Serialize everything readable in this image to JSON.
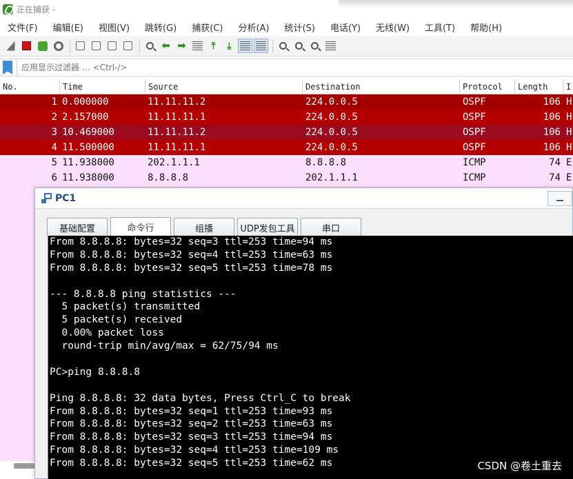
{
  "wireshark": {
    "title": "正在捕获 -",
    "menu": [
      "文件(F)",
      "编辑(E)",
      "视图(V)",
      "跳转(G)",
      "捕获(C)",
      "分析(A)",
      "统计(S)",
      "电话(Y)",
      "无线(W)",
      "工具(T)",
      "帮助(H)"
    ],
    "filter_placeholder": "应用显示过滤器 … <Ctrl-/>",
    "columns": [
      "No.",
      "Time",
      "Source",
      "Destination",
      "Protocol",
      "Length",
      "I"
    ],
    "rows": [
      {
        "no": "1",
        "time": "0.000000",
        "src": "11.11.11.2",
        "dst": "224.0.0.5",
        "proto": "OSPF",
        "len": "106",
        "info": "H",
        "bg": "#a40000",
        "fg": "#ffffff"
      },
      {
        "no": "2",
        "time": "2.157000",
        "src": "11.11.11.1",
        "dst": "224.0.0.5",
        "proto": "OSPF",
        "len": "106",
        "info": "H",
        "bg": "#b50000",
        "fg": "#ffffff"
      },
      {
        "no": "3",
        "time": "10.469000",
        "src": "11.11.11.2",
        "dst": "224.0.0.5",
        "proto": "OSPF",
        "len": "106",
        "info": "H",
        "bg": "#9c0a1e",
        "fg": "#ffffff"
      },
      {
        "no": "4",
        "time": "11.500000",
        "src": "11.11.11.1",
        "dst": "224.0.0.5",
        "proto": "OSPF",
        "len": "106",
        "info": "H",
        "bg": "#b50000",
        "fg": "#ffffff"
      },
      {
        "no": "5",
        "time": "11.938000",
        "src": "202.1.1.1",
        "dst": "8.8.8.8",
        "proto": "ICMP",
        "len": "74",
        "info": "E",
        "bg": "#fde0fe",
        "fg": "#111111"
      },
      {
        "no": "6",
        "time": "11.938000",
        "src": "8.8.8.8",
        "dst": "202.1.1.1",
        "proto": "ICMP",
        "len": "74",
        "info": "E",
        "bg": "#fde0fe",
        "fg": "#111111"
      }
    ]
  },
  "pc_window": {
    "title": "PC1",
    "tabs": [
      {
        "label": "基础配置",
        "width": 88
      },
      {
        "label": "命令行",
        "width": 88
      },
      {
        "label": "组播",
        "width": 88
      },
      {
        "label": "UDP发包工具",
        "width": 88
      },
      {
        "label": "串口",
        "width": 88
      }
    ],
    "active_tab": 1,
    "terminal_lines": [
      "From 8.8.8.8: bytes=32 seq=3 ttl=253 time=94 ms",
      "From 8.8.8.8: bytes=32 seq=4 ttl=253 time=63 ms",
      "From 8.8.8.8: bytes=32 seq=5 ttl=253 time=78 ms",
      "",
      "--- 8.8.8.8 ping statistics ---",
      "  5 packet(s) transmitted",
      "  5 packet(s) received",
      "  0.00% packet loss",
      "  round-trip min/avg/max = 62/75/94 ms",
      "",
      "PC>ping 8.8.8.8",
      "",
      "Ping 8.8.8.8: 32 data bytes, Press Ctrl_C to break",
      "From 8.8.8.8: bytes=32 seq=1 ttl=253 time=93 ms",
      "From 8.8.8.8: bytes=32 seq=2 ttl=253 time=63 ms",
      "From 8.8.8.8: bytes=32 seq=3 ttl=253 time=94 ms",
      "From 8.8.8.8: bytes=32 seq=4 ttl=253 time=109 ms",
      "From 8.8.8.8: bytes=32 seq=5 ttl=253 time=62 ms"
    ]
  },
  "watermark": "CSDN @卷土重去"
}
